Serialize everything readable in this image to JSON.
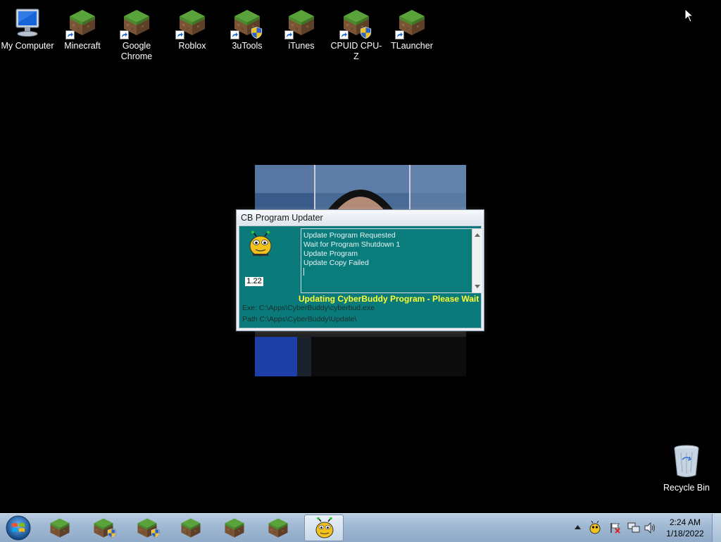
{
  "desktop": {
    "icons": [
      {
        "label": "My Computer",
        "icon": "my-computer-icon",
        "shortcut": false,
        "shield": false
      },
      {
        "label": "Minecraft",
        "icon": "minecraft-icon",
        "shortcut": true,
        "shield": false
      },
      {
        "label": "Google Chrome",
        "icon": "minecraft-icon",
        "shortcut": true,
        "shield": false
      },
      {
        "label": "Roblox",
        "icon": "minecraft-icon",
        "shortcut": true,
        "shield": false
      },
      {
        "label": "3uTools",
        "icon": "minecraft-icon",
        "shortcut": true,
        "shield": true
      },
      {
        "label": "iTunes",
        "icon": "minecraft-icon",
        "shortcut": true,
        "shield": false
      },
      {
        "label": "CPUID CPU-Z",
        "icon": "minecraft-icon",
        "shortcut": true,
        "shield": true
      },
      {
        "label": "TLauncher",
        "icon": "minecraft-icon",
        "shortcut": true,
        "shield": false
      }
    ],
    "recycle_bin_label": "Recycle Bin"
  },
  "dialog": {
    "title": "CB Program Updater",
    "version": "1.22",
    "log": [
      "Update Program Requested",
      "Wait for Program Shutdown 1",
      "Update Program",
      "Update Copy Failed"
    ],
    "status": "Updating CyberBuddy Program - Please Wait",
    "exe_path": "Exe: C:\\Apps\\CyberBuddy\\cyberbud.exe",
    "dir_path": "Path C:\\Apps\\CyberBuddy\\Update\\"
  },
  "taskbar": {
    "buttons": [
      {
        "icon": "minecraft-icon",
        "shield": false
      },
      {
        "icon": "minecraft-icon",
        "shield": true
      },
      {
        "icon": "minecraft-icon",
        "shield": true
      },
      {
        "icon": "minecraft-icon",
        "shield": false
      },
      {
        "icon": "minecraft-icon",
        "shield": false
      },
      {
        "icon": "minecraft-icon",
        "shield": false
      },
      {
        "icon": "cyberbuddy-icon",
        "shield": false,
        "active": true
      }
    ],
    "tray_icons": [
      "show-hidden-icons-arrow",
      "cyberbuddy-tray-icon",
      "action-center-flag-icon",
      "network-icon",
      "volume-icon"
    ],
    "clock": {
      "time": "2:24 AM",
      "date": "1/18/2022"
    }
  },
  "colors": {
    "dialog_body": "#0a7a7a",
    "status_text": "#ffff33",
    "taskbar": "#9fb8d2"
  }
}
